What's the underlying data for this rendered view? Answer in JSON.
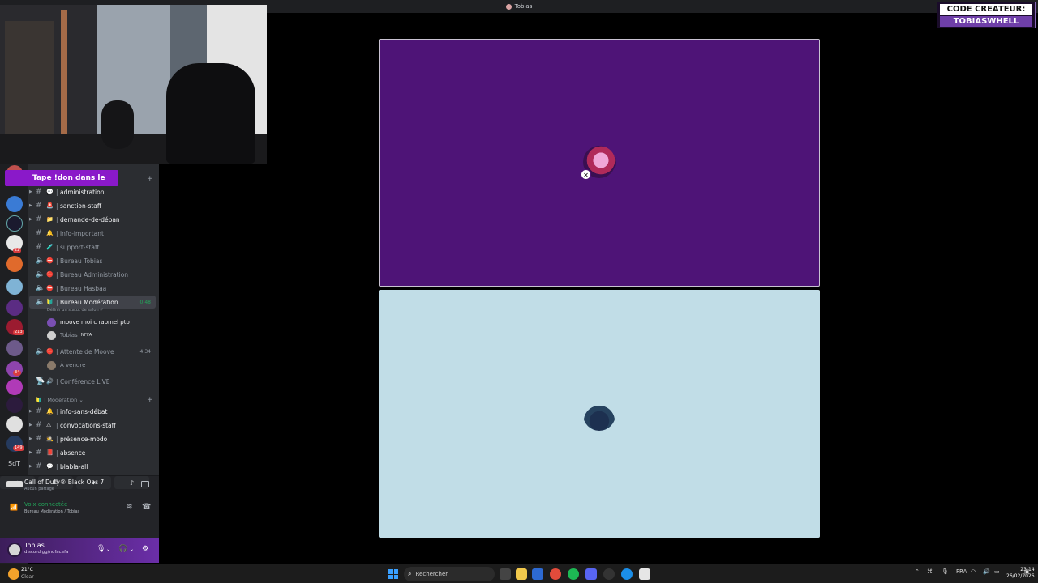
{
  "window": {
    "title": "Tobias"
  },
  "overlay": {
    "creator_code_label": "CODE CREATEUR:",
    "creator_code_value": "TOBIASWHELL"
  },
  "promo_banner": "Tape !don dans le",
  "server_rail": {
    "badges": [
      "22",
      "213",
      "34",
      "149"
    ],
    "text_icon": "SdT"
  },
  "channels": [
    {
      "name": "administration",
      "type": "text",
      "emoji": "💬",
      "muted": false
    },
    {
      "name": "sanction-staff",
      "type": "text",
      "emoji": "🚨",
      "muted": false
    },
    {
      "name": "demande-de-déban",
      "type": "text",
      "emoji": "📁",
      "muted": false
    },
    {
      "name": "info-important",
      "type": "text",
      "emoji": "🔔",
      "muted": true
    },
    {
      "name": "support-staff",
      "type": "text",
      "emoji": "🧪",
      "muted": true
    },
    {
      "name": "Bureau Tobias",
      "type": "voice",
      "emoji": "⛔",
      "muted": true
    },
    {
      "name": "Bureau Administration",
      "type": "voice",
      "emoji": "⛔",
      "muted": true
    },
    {
      "name": "Bureau Hasbaa",
      "type": "voice",
      "emoji": "⛔",
      "muted": true
    },
    {
      "name": "Bureau Modération",
      "type": "voice",
      "emoji": "🔰",
      "muted": false,
      "active": true,
      "time": "0:48",
      "status_hint": "Définir un statut de salon ✐"
    },
    {
      "name": "Attente de Moove",
      "type": "voice",
      "emoji": "⛔",
      "muted": true,
      "time": "4:34"
    },
    {
      "name": "Conférence LIVE",
      "type": "voice",
      "emoji": "🔊",
      "muted": true
    }
  ],
  "voice_members": {
    "moderation": [
      {
        "name": "moove moi c rabmel pto",
        "tag": ""
      },
      {
        "name": "Tobias",
        "tag": "NFFA"
      }
    ],
    "attente": [
      {
        "name": "À vendre",
        "tag": ""
      }
    ]
  },
  "category": {
    "label": "Modération"
  },
  "category_channels": [
    {
      "name": "info-sans-débat",
      "emoji": "🔔"
    },
    {
      "name": "convocations-staff",
      "emoji": "⚠"
    },
    {
      "name": "présence-modo",
      "emoji": "🕵"
    },
    {
      "name": "absence",
      "emoji": "📕"
    },
    {
      "name": "blabla-all",
      "emoji": "💬"
    }
  ],
  "activity": {
    "game_title": "Call of Duty® Black Ops 7",
    "game_sub": "Aucun partage",
    "voice_title": "Voix connectée",
    "voice_sub": "Bureau Modération / Tobias"
  },
  "user": {
    "name": "Tobias",
    "status": "discord.gg/nofacefa"
  },
  "taskbar": {
    "temp": "21°C",
    "condition": "Clear",
    "search_placeholder": "Rechercher",
    "lang": "FRA",
    "time": "23:14",
    "date": "26/02/2026"
  },
  "colors": {
    "stage_top": "#4e1477",
    "stage_bottom": "#c1dde7",
    "promo": "#8a19c9",
    "voice_green": "#23a55a"
  }
}
